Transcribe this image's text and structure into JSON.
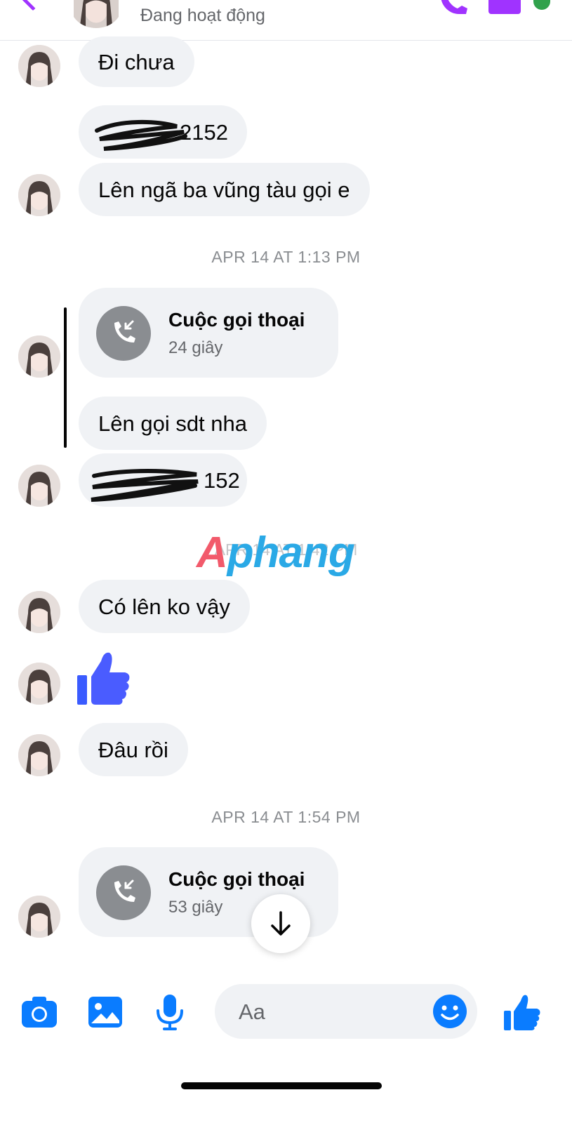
{
  "header": {
    "status": "Đang hoạt động"
  },
  "messages": [
    {
      "text": "Đi chưa"
    },
    {
      "text": "2152"
    },
    {
      "text": "Lên ngã ba vũng tàu gọi e"
    },
    {
      "timestamp": "APR 14 AT 1:13 PM"
    },
    {
      "call_title": "Cuộc gọi thoại",
      "call_duration": "24 giây"
    },
    {
      "text": "Lên gọi sdt nha"
    },
    {
      "text": "152"
    },
    {
      "timestamp": "APR 14 AT 1:42 PM"
    },
    {
      "text": "Có lên ko vậy"
    },
    {
      "text": "Đâu rồi"
    },
    {
      "timestamp": "APR 14 AT 1:54 PM"
    },
    {
      "call_title": "Cuộc gọi thoại",
      "call_duration": "53 giây"
    }
  ],
  "watermark": {
    "first": "A",
    "rest": "phang"
  },
  "composer": {
    "placeholder": "Aa"
  },
  "colors": {
    "accent": "#0a7cff",
    "header_accent": "#a033ff",
    "bubble": "#f0f2f5",
    "active": "#31a24c"
  },
  "icons": [
    "back-icon",
    "phone-icon",
    "video-icon",
    "call-incoming-icon",
    "thumbs-up-icon",
    "arrow-down-icon",
    "camera-icon",
    "image-icon",
    "microphone-icon",
    "emoji-icon"
  ]
}
